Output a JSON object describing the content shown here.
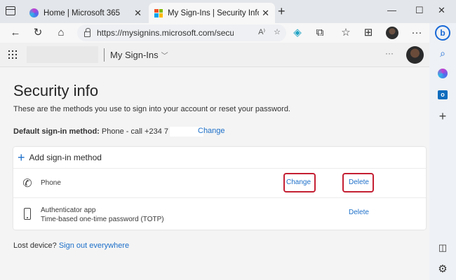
{
  "browser": {
    "tabs": [
      {
        "title": "Home | Microsoft 365",
        "icon": "microsoft-365-icon"
      },
      {
        "title": "My Sign-Ins | Security Info | Microsoft",
        "icon": "microsoft-logo-icon"
      }
    ],
    "close_glyph": "✕",
    "new_tab_glyph": "+",
    "address": "https://mysignins.microsoft.com/security-i...",
    "address_icons": [
      "read-aloud-icon",
      "favorite-add-icon"
    ],
    "toolbar_icons": [
      "back-icon",
      "refresh-icon",
      "home-icon",
      "tracker-shield-icon",
      "extensions-icon",
      "favorites-icon",
      "collections-icon",
      "profile-avatar",
      "more-icon"
    ],
    "window_controls": [
      "minimize",
      "maximize",
      "close"
    ]
  },
  "sidebar": {
    "icons": [
      "bing-copilot-icon",
      "search-icon",
      "microsoft-365-icon",
      "outlook-icon",
      "add-icon",
      "sidebar-toggle-icon",
      "settings-icon"
    ]
  },
  "header": {
    "app_title": "My Sign-Ins",
    "more": "···"
  },
  "main": {
    "title": "Security info",
    "description": "These are the methods you use to sign into your account or reset your password.",
    "default_label": "Default sign-in method:",
    "default_value": "Phone - call +234 7",
    "default_change": "Change",
    "add_method": "Add sign-in method",
    "methods": [
      {
        "name": "Phone",
        "detail": "",
        "icon": "phone-icon",
        "change": "Change",
        "delete": "Delete"
      },
      {
        "name": "Authenticator app",
        "detail": "Time-based one-time password (TOTP)",
        "icon": "mobile-device-icon",
        "delete": "Delete"
      }
    ],
    "lost_label": "Lost device?",
    "lost_link": "Sign out everywhere"
  },
  "colors": {
    "accent": "#1c6fc9",
    "highlight": "#c41f33"
  }
}
